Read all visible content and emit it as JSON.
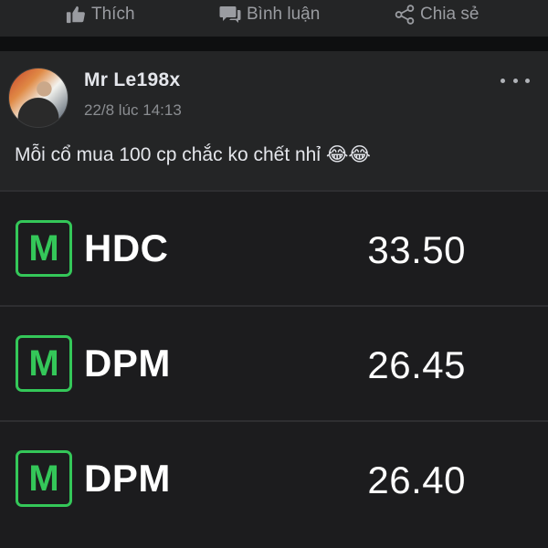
{
  "actions": {
    "like_label": "Thích",
    "comment_label": "Bình luận",
    "share_label": "Chia sẻ"
  },
  "post": {
    "author": "Mr Le198x",
    "timestamp": "22/8 lúc 14:13",
    "text": "Mỗi cổ mua 100 cp chắc ko chết nhỉ 😂😂"
  },
  "stocks": [
    {
      "badge": "M",
      "ticker": "HDC",
      "price": "33.50"
    },
    {
      "badge": "M",
      "ticker": "DPM",
      "price": "26.45"
    },
    {
      "badge": "M",
      "ticker": "DPM",
      "price": "26.40"
    }
  ],
  "colors": {
    "background": "#18191a",
    "card": "#242526",
    "badge_green": "#34c759",
    "muted_text": "#9a9ca1"
  },
  "icons": {
    "like": "thumbs-up-icon",
    "comment": "comment-icon",
    "share": "share-icon",
    "more": "more-options-icon"
  }
}
